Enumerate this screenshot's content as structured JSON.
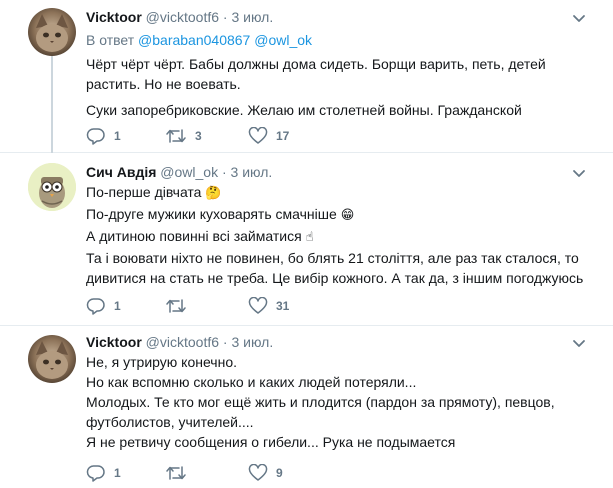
{
  "tweets": [
    {
      "name": "Vicktoor",
      "handle": "@vicktootf6",
      "sep": "·",
      "time": "3 июл.",
      "reply_prefix": "В ответ",
      "reply_to": [
        "@baraban040867",
        "@owl_ok"
      ],
      "lines": [
        "Чёрт чёрт чёрт. Бабы должны дома сидеть. Борщи варить, петь, детей",
        "растить. Но не воевать.",
        "Суки запоребриковские. Желаю им столетней войны. Гражданской"
      ],
      "replies": "1",
      "retweets": "3",
      "likes": "17"
    },
    {
      "name": "Сич Авдія",
      "handle": "@owl_ok",
      "sep": "·",
      "time": "3 июл.",
      "lines": [
        "По-перше дівчата",
        "По-друге мужики куховарять смачніше",
        "А дитиною повинні всі займатися",
        "Та і воювати ніхто не повинен, бо блять 21 століття, але раз так сталося, то",
        "дивитися на стать не треба. Це вибір кожного. А так да, з іншим погоджуюсь"
      ],
      "emojis": [
        "🤔",
        "😁",
        "☝"
      ],
      "replies": "1",
      "retweets": "",
      "likes": "31"
    },
    {
      "name": "Vicktoor",
      "handle": "@vicktootf6",
      "sep": "·",
      "time": "3 июл.",
      "lines": [
        "Не, я утрирую конечно.",
        "Но как вспомню сколько и каких людей потеряли...",
        "Молодых. Те кто мог ещё жить и плодится (пардон за прямоту), певцов,",
        "футболистов, учителей....",
        "Я не ретвичу сообщения о гибели... Рука не подымается"
      ],
      "replies": "1",
      "retweets": "",
      "likes": "9"
    }
  ],
  "colors": {
    "text": "#14171a",
    "muted": "#657786",
    "link": "#1b95e0",
    "divider": "#e6ecf0",
    "thread": "#ccd6dd"
  },
  "icons": [
    "reply-icon",
    "retweet-icon",
    "like-icon",
    "chevron-down-icon"
  ]
}
